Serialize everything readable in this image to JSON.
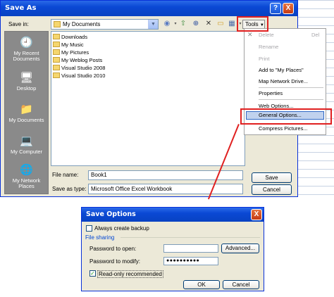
{
  "save_as": {
    "title": "Save As",
    "help_label": "?",
    "close_label": "X",
    "save_in_label": "Save in:",
    "save_in_value": "My Documents",
    "tools_label": "Tools",
    "places": [
      {
        "label": "My Recent Documents",
        "icon": "recent-documents-icon"
      },
      {
        "label": "Desktop",
        "icon": "desktop-icon"
      },
      {
        "label": "My Documents",
        "icon": "my-documents-icon"
      },
      {
        "label": "My Computer",
        "icon": "my-computer-icon"
      },
      {
        "label": "My Network Places",
        "icon": "network-places-icon"
      }
    ],
    "files": [
      "Downloads",
      "My Music",
      "My Pictures",
      "My Weblog Posts",
      "Visual Studio 2008",
      "Visual Studio 2010"
    ],
    "file_name_label": "File name:",
    "file_name_value": "Book1",
    "save_as_type_label": "Save as type:",
    "save_as_type_value": "Microsoft Office Excel Workbook",
    "save_button": "Save",
    "cancel_button": "Cancel"
  },
  "tools_menu": {
    "delete": "Delete",
    "delete_shortcut": "Del",
    "rename": "Rename",
    "print": "Print",
    "add_to_places": "Add to \"My Places\"",
    "map_drive": "Map Network Drive...",
    "properties": "Properties",
    "web_options": "Web Options...",
    "general_options": "General Options...",
    "compress_pictures": "Compress Pictures..."
  },
  "save_options": {
    "title": "Save Options",
    "close_label": "X",
    "always_backup": "Always create backup",
    "file_sharing": "File sharing",
    "password_open_label": "Password to open:",
    "password_open_value": "",
    "advanced_button": "Advanced...",
    "password_modify_label": "Password to modify:",
    "password_modify_value": "●●●●●●●●●●",
    "read_only_label": "Read-only recommended",
    "ok_button": "OK",
    "cancel_button": "Cancel"
  },
  "colors": {
    "highlight": "#e02020",
    "titlebar": "#0a48d4"
  }
}
